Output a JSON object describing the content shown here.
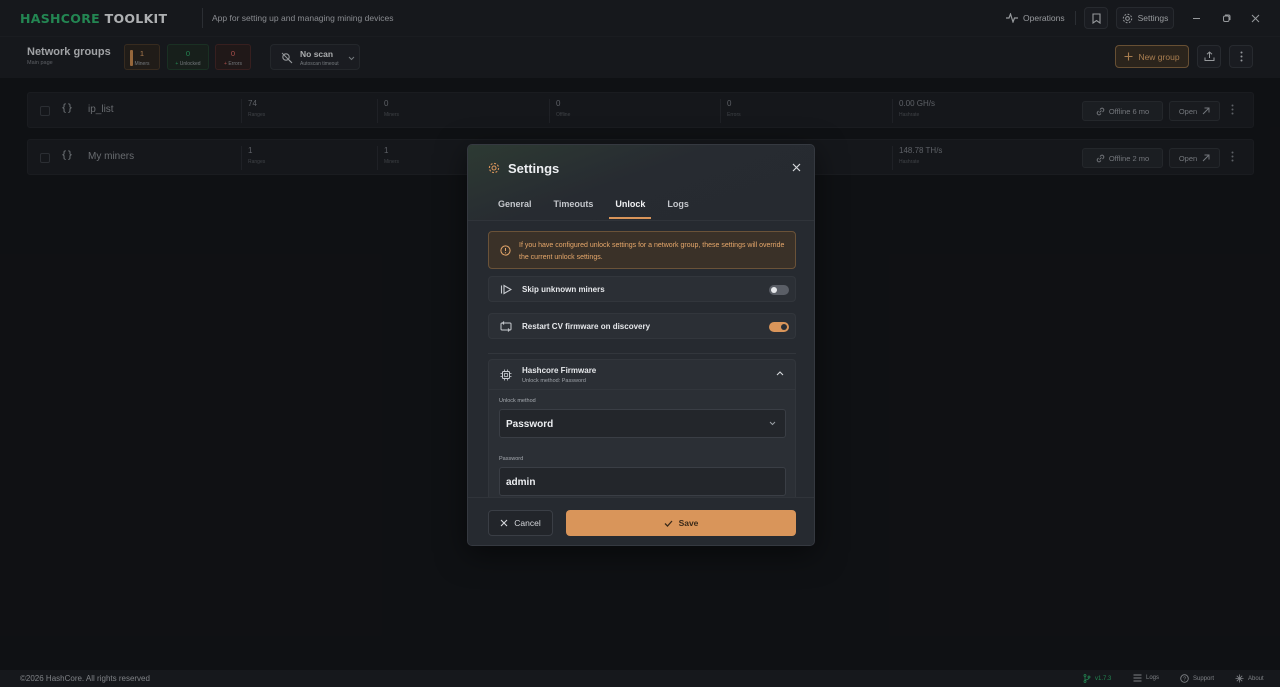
{
  "app": {
    "logo_part1": "HASHCORE",
    "logo_part2": "TOOLKIT",
    "tagline": "App for setting up and managing mining devices",
    "operations_label": "Operations",
    "settings_label": "Settings"
  },
  "toolbar": {
    "title": "Network groups",
    "subtitle": "Main page",
    "stats": [
      {
        "value": "1",
        "label": "Miners",
        "color": "#c98a4f"
      },
      {
        "value": "0",
        "label": "Unlocked",
        "color": "#2fb36e"
      },
      {
        "value": "0",
        "label": "Errors",
        "color": "#d9534f"
      }
    ],
    "scan_title": "No scan",
    "scan_sub": "Autoscan timeout",
    "new_group_label": "New group"
  },
  "rows": [
    {
      "name": "ip_list",
      "cols": [
        {
          "value": "74",
          "label": "Ranges"
        },
        {
          "value": "0",
          "label": "Miners"
        },
        {
          "value": "0",
          "label": "Offline"
        },
        {
          "value": "0",
          "label": "Errors"
        },
        {
          "value": "0.00 GH/s",
          "label": "Hashrate"
        }
      ],
      "status": "Offline 6 mo",
      "open": "Open"
    },
    {
      "name": "My miners",
      "cols": [
        {
          "value": "1",
          "label": "Ranges"
        },
        {
          "value": "1",
          "label": "Miners"
        },
        {
          "value": "",
          "label": ""
        },
        {
          "value": "",
          "label": ""
        },
        {
          "value": "148.78 TH/s",
          "label": "Hashrate"
        }
      ],
      "status": "Offline 2 mo",
      "open": "Open"
    }
  ],
  "modal": {
    "title": "Settings",
    "tabs": [
      "General",
      "Timeouts",
      "Unlock",
      "Logs"
    ],
    "active_tab": "Unlock",
    "notice": "If you have configured unlock settings for a network group, these settings will override the current unlock settings.",
    "options": [
      {
        "label": "Skip unknown miners",
        "enabled": false
      },
      {
        "label": "Restart CV firmware on discovery",
        "enabled": true
      }
    ],
    "firmware": {
      "title": "Hashcore Firmware",
      "subtitle": "Unlock method: Password",
      "method_label": "Unlock method",
      "method_value": "Password",
      "password_label": "Password",
      "password_value": "admin"
    },
    "cancel_label": "Cancel",
    "save_label": "Save"
  },
  "footer": {
    "copyright": "©2026 HashCore. All rights reserved",
    "version": "v1.7.3",
    "logs": "Logs",
    "support": "Support",
    "about": "About"
  },
  "colors": {
    "accent": "#d9955a",
    "brand_green": "#2fb36e"
  }
}
